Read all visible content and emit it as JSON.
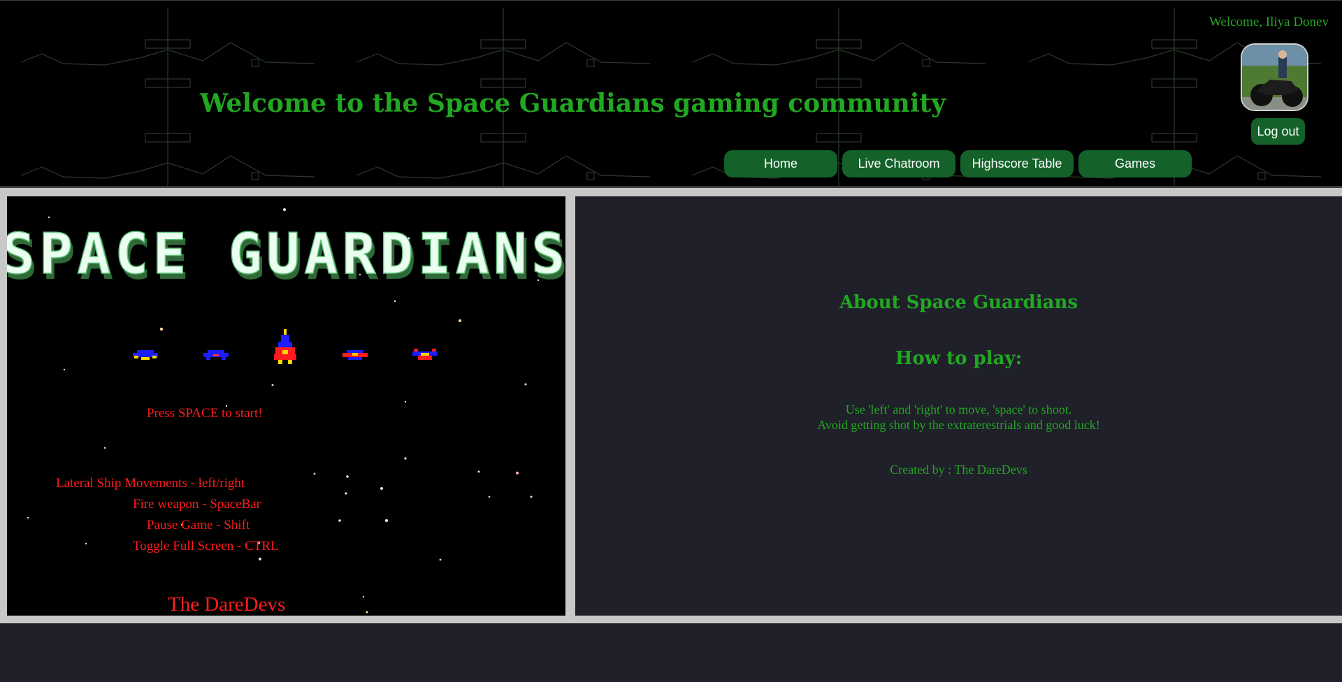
{
  "header": {
    "title": "Welcome to the Space Guardians gaming community",
    "welcome": "Welcome, Iliya Donev",
    "logout_label": "Log out",
    "nav": [
      {
        "label": "Home"
      },
      {
        "label": "Live Chatroom"
      },
      {
        "label": "Highscore Table"
      },
      {
        "label": "Games"
      }
    ]
  },
  "game": {
    "logo": "SPACE GUARDIANS",
    "prompt": "Press SPACE to start!",
    "controls": [
      "Lateral Ship Movements - left/right",
      "Fire weapon - SpaceBar",
      "Pause Game - Shift",
      "Toggle Full Screen - CTRL"
    ],
    "credit": "The DareDevs"
  },
  "about": {
    "title": "About Space Guardians",
    "subtitle": "How to play:",
    "instructions": [
      "Use 'left' and 'right' to move, 'space' to shoot.",
      "Avoid getting shot by the extraterestrials and good luck!"
    ],
    "credits": "Created by : The DareDevs"
  },
  "colors": {
    "accent_green": "#22a722",
    "button_green": "#14612a",
    "text_red": "#ff1c1c",
    "panel_dark": "#1f2029"
  }
}
